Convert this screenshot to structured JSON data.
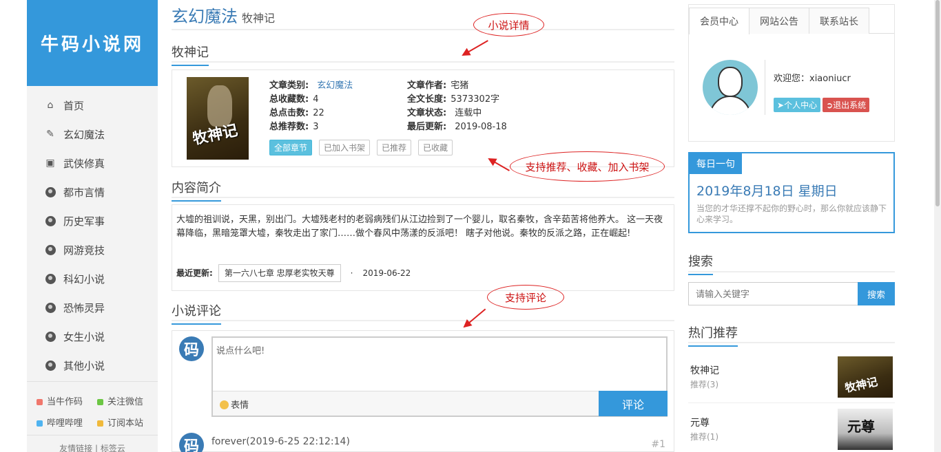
{
  "sidebar": {
    "logo": "牛码小说网",
    "nav": [
      {
        "label": "首页",
        "icon": "home-icon"
      },
      {
        "label": "玄幻魔法",
        "icon": "eraser-icon"
      },
      {
        "label": "武侠修真",
        "icon": "inbox-icon"
      },
      {
        "label": "都市言情",
        "icon": "globe-icon"
      },
      {
        "label": "历史军事",
        "icon": "globe-icon"
      },
      {
        "label": "网游竞技",
        "icon": "globe-icon"
      },
      {
        "label": "科幻小说",
        "icon": "globe-icon"
      },
      {
        "label": "恐怖灵异",
        "icon": "globe-icon"
      },
      {
        "label": "女生小说",
        "icon": "globe-icon"
      },
      {
        "label": "其他小说",
        "icon": "globe-icon"
      }
    ],
    "links": [
      {
        "label": "当牛作码",
        "color": "#f0776c"
      },
      {
        "label": "关注微信",
        "color": "#6cc644"
      },
      {
        "label": "哔哩哔哩",
        "color": "#4fb3f0"
      },
      {
        "label": "订阅本站",
        "color": "#f0b93b"
      }
    ],
    "friend_links": "友情链接 | 标签云"
  },
  "main": {
    "category": "玄幻魔法",
    "category_sub": "牧神记",
    "book_title": "牧神记",
    "details": {
      "category_label": "文章类别:",
      "category_value": "玄幻魔法",
      "fav_label": "总收藏数:",
      "fav_value": "4",
      "click_label": "总点击数:",
      "click_value": "22",
      "rec_label": "总推荐数:",
      "rec_value": "3",
      "author_label": "文章作者:",
      "author_value": "宅猪",
      "length_label": "全文长度:",
      "length_value": "5373302字",
      "status_label": "文章状态:",
      "status_value": "连载中",
      "updated_label": "最后更新:",
      "updated_value": "2019-08-18"
    },
    "cover_title": "牧神记",
    "buttons": {
      "all_chapters": "全部章节",
      "bookshelf": "已加入书架",
      "recommended": "已推荐",
      "favorited": "已收藏"
    },
    "intro_heading": "内容简介",
    "intro_text": "大墟的祖训说，天黑，别出门。大墟残老村的老弱病残们从江边捡到了一个婴儿，取名秦牧，含辛茹苦将他养大。 这一天夜幕降临，黑暗笼罩大墟，秦牧走出了家门……做个春风中荡漾的反派吧！ 瞎子对他说。秦牧的反派之路，正在崛起!",
    "latest_label": "最近更新:",
    "latest_chapter": "第一六八七章 忠厚老实牧天尊",
    "latest_sep": "·",
    "latest_date": "2019-06-22",
    "comment_heading": "小说评论",
    "comment_placeholder": "说点什么吧!",
    "emoji_label": "表情",
    "comment_submit": "评论",
    "avatar_char": "码",
    "comment_item": "forever(2019-6-25 22:12:14)",
    "comment_num": "#1"
  },
  "annotations": {
    "detail": "小说详情",
    "support": "支持推荐、收藏、加入书架",
    "comment": "支持评论"
  },
  "right": {
    "tabs": [
      "会员中心",
      "网站公告",
      "联系站长"
    ],
    "welcome": "欢迎您：xiaoniucr",
    "personal_center": "个人中心",
    "logout": "退出系统",
    "daily_label": "每日一句",
    "daily_date": "2019年8月18日 星期日",
    "daily_quote": "当您的才华还撑不起你的野心时，那么你就应该静下心来学习。",
    "search_heading": "搜索",
    "search_placeholder": "请输入关键字",
    "search_button": "搜索",
    "hot_heading": "热门推荐",
    "hot": [
      {
        "name": "牧神记",
        "rec": "推荐(3)"
      },
      {
        "name": "元尊",
        "rec": "推荐(1)"
      }
    ],
    "hot_thumb_2": "元尊"
  }
}
